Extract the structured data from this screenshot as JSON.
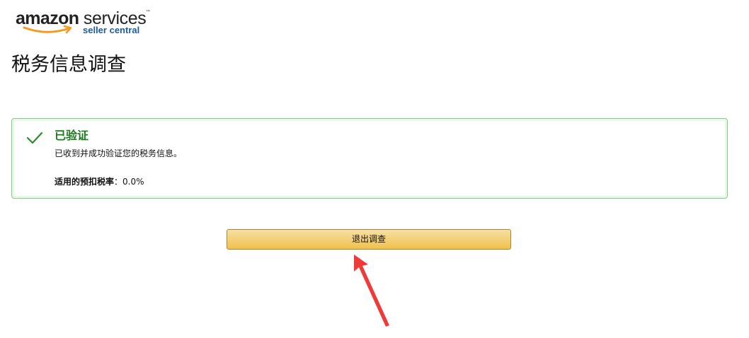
{
  "logo": {
    "brand": "amazon",
    "product": "services",
    "tm": "™",
    "subtitle": "seller central",
    "colors": {
      "smile": "#f39a1f",
      "subtitle": "#1d5c97"
    }
  },
  "page": {
    "title": "税务信息调查"
  },
  "alert": {
    "status": "success",
    "icon": "check-icon",
    "heading": "已验证",
    "message": "已收到并成功验证您的税务信息。",
    "rate_label": "适用的预扣税率",
    "rate_separator": "：",
    "rate_value": "0.0%",
    "colors": {
      "border": "#7ed07a",
      "heading": "#1b7a1b",
      "check": "#2c8a2c"
    }
  },
  "actions": {
    "exit_button_label": "退出调查",
    "colors": {
      "button_top": "#f7dfa5",
      "button_bottom": "#f0c14b",
      "button_border": "#a88734"
    }
  },
  "annotation": {
    "icon": "red-arrow-icon",
    "color": "#f03a3a"
  }
}
